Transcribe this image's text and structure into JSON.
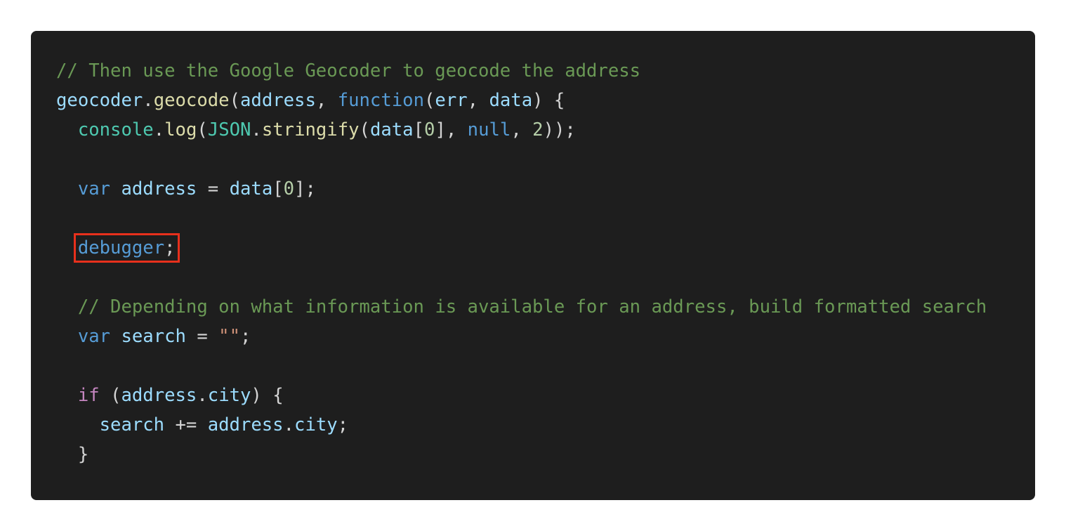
{
  "colors": {
    "background": "#1e1e1e",
    "comment": "#6a9955",
    "variable": "#9cdcfe",
    "function": "#dcdcaa",
    "keyword": "#569cd6",
    "control": "#c586c0",
    "class": "#4ec9b0",
    "number": "#b5cea8",
    "string": "#ce9178",
    "punctuation": "#d4d4d4",
    "highlight_border": "#e8301c"
  },
  "code": {
    "line1": {
      "comment": "// Then use the Google Geocoder to geocode the address"
    },
    "line2": {
      "obj": "geocoder",
      "dot": ".",
      "method": "geocode",
      "open": "(",
      "arg1": "address",
      "comma1": ", ",
      "kw_function": "function",
      "open2": "(",
      "param1": "err",
      "comma2": ", ",
      "param2": "data",
      "close": ") {"
    },
    "line3": {
      "indent": "  ",
      "obj": "console",
      "dot1": ".",
      "method": "log",
      "open1": "(",
      "cls": "JSON",
      "dot2": ".",
      "method2": "stringify",
      "open2": "(",
      "arg": "data",
      "bracket_open": "[",
      "index": "0",
      "bracket_close": "], ",
      "kw_null": "null",
      "comma": ", ",
      "num": "2",
      "close": "));"
    },
    "line4": {
      "text": ""
    },
    "line5": {
      "indent": "  ",
      "kw_var": "var",
      "space1": " ",
      "name": "address",
      "eq": " = ",
      "value": "data",
      "bracket_open": "[",
      "index": "0",
      "bracket_close": "];"
    },
    "line6": {
      "text": ""
    },
    "line7": {
      "indent": "  ",
      "kw_debugger": "debugger",
      "semi": ";"
    },
    "line8": {
      "text": ""
    },
    "line9": {
      "indent": "  ",
      "comment": "// Depending on what information is available for an address, build formatted search"
    },
    "line10": {
      "indent": "  ",
      "kw_var": "var",
      "space1": " ",
      "name": "search",
      "eq": " = ",
      "str": "\"\"",
      "semi": ";"
    },
    "line11": {
      "text": ""
    },
    "line12": {
      "indent": "  ",
      "kw_if": "if",
      "open": " (",
      "obj": "address",
      "dot": ".",
      "prop": "city",
      "close": ") {"
    },
    "line13": {
      "indent": "    ",
      "name": "search",
      "op": " += ",
      "obj": "address",
      "dot": ".",
      "prop": "city",
      "semi": ";"
    },
    "line14": {
      "indent": "  ",
      "brace": "}"
    }
  }
}
